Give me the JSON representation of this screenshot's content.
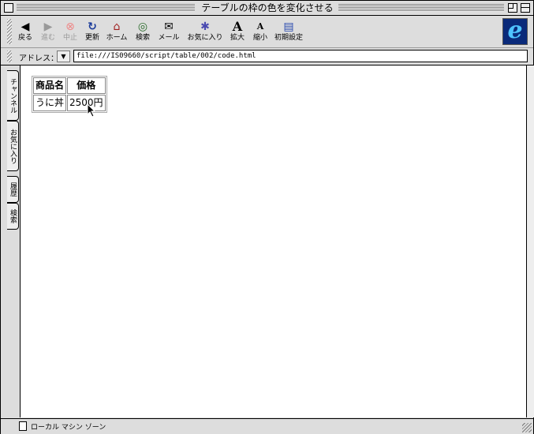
{
  "window": {
    "title": "テーブルの枠の色を変化させる"
  },
  "toolbar": {
    "buttons": [
      {
        "label": "戻る",
        "icon": "back-arrow-icon",
        "glyph": "◀"
      },
      {
        "label": "進む",
        "icon": "forward-arrow-icon",
        "glyph": "▶"
      },
      {
        "label": "中止",
        "icon": "stop-icon",
        "glyph": "⊗"
      },
      {
        "label": "更新",
        "icon": "refresh-icon",
        "glyph": "↻"
      },
      {
        "label": "ホーム",
        "icon": "home-icon",
        "glyph": "⌂"
      },
      {
        "label": "検索",
        "icon": "search-icon",
        "glyph": "◎"
      },
      {
        "label": "メール",
        "icon": "mail-icon",
        "glyph": "✉"
      },
      {
        "label": "お気に入り",
        "icon": "favorites-icon",
        "glyph": "✱"
      },
      {
        "label": "拡大",
        "icon": "text-larger-icon",
        "glyph": "A"
      },
      {
        "label": "縮小",
        "icon": "text-smaller-icon",
        "glyph": "A"
      },
      {
        "label": "初期設定",
        "icon": "preferences-icon",
        "glyph": "▤"
      }
    ],
    "logo": "e"
  },
  "address": {
    "label": "アドレス：",
    "value": "file:///IS09660/script/table/002/code.html"
  },
  "sidebar": {
    "tabs": [
      "チャンネル",
      "お気に入り",
      "履歴",
      "検索"
    ]
  },
  "table": {
    "headers": [
      "商品名",
      "価格"
    ],
    "rows": [
      [
        "うに丼",
        "2500円"
      ]
    ]
  },
  "status": {
    "zone": "ローカル マシン ゾーン"
  }
}
